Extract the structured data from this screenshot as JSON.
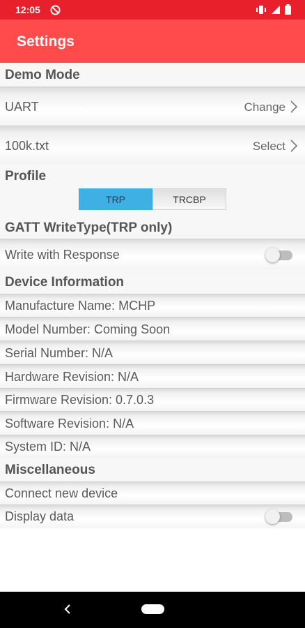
{
  "status_bar": {
    "time": "12:05",
    "left_icon": "do-not-disturb-icon",
    "right_icons": [
      "vibrate-icon",
      "signal-icon",
      "battery-icon"
    ]
  },
  "app_bar": {
    "title": "Settings"
  },
  "sections": {
    "demo_mode": "Demo Mode",
    "profile": "Profile",
    "gatt": "GATT WriteType(TRP only)",
    "device_info": "Device Information",
    "misc": "Miscellaneous"
  },
  "demo_mode": {
    "mode": {
      "label": "UART",
      "action": "Change"
    },
    "file": {
      "label": "100k.txt",
      "action": "Select"
    }
  },
  "profile": {
    "options": [
      "TRP",
      "TRCBP"
    ],
    "selected": "TRP"
  },
  "gatt": {
    "write_with_response": {
      "label": "Write with Response",
      "enabled": false
    }
  },
  "device_info": {
    "manufacturer": "Manufacture Name: MCHP",
    "model": "Model Number: Coming Soon",
    "serial": "Serial Number: N/A",
    "hardware": "Hardware Revision: N/A",
    "firmware": "Firmware Revision: 0.7.0.3",
    "software": "Software Revision: N/A",
    "system_id": "System ID: N/A"
  },
  "misc": {
    "connect": "Connect new device",
    "display_data": {
      "label": "Display data",
      "enabled": false
    }
  },
  "colors": {
    "status_bar": "#e8202b",
    "app_bar": "#ff4b4b",
    "segment_active": "#3fb0e3"
  },
  "nav_icons": [
    "back-icon",
    "home-pill-icon"
  ]
}
